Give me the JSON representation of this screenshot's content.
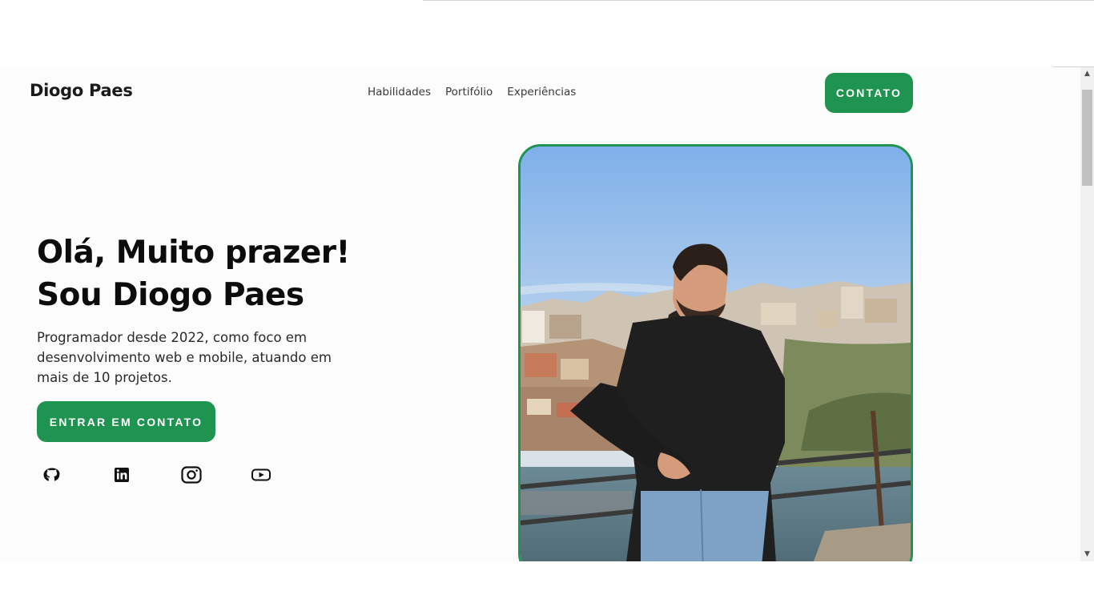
{
  "nav": {
    "brand": "Diogo Paes",
    "links": [
      "Habilidades",
      "Portifólio",
      "Experiências"
    ],
    "cta": "CONTATO"
  },
  "hero": {
    "title_line1": "Olá, Muito prazer!",
    "title_line2": "Sou Diogo Paes",
    "description": "Programador desde 2022, como foco em desenvolvimento web e mobile, atuando em mais de 10 projetos.",
    "cta": "ENTRAR EM CONTATO"
  },
  "socials": [
    {
      "name": "github",
      "icon": "github-icon"
    },
    {
      "name": "linkedin",
      "icon": "linkedin-icon"
    },
    {
      "name": "instagram",
      "icon": "instagram-icon"
    },
    {
      "name": "youtube",
      "icon": "youtube-icon"
    }
  ],
  "colors": {
    "accent": "#1f9350",
    "background": "#fcfcfc",
    "text": "#0c0c0c"
  }
}
